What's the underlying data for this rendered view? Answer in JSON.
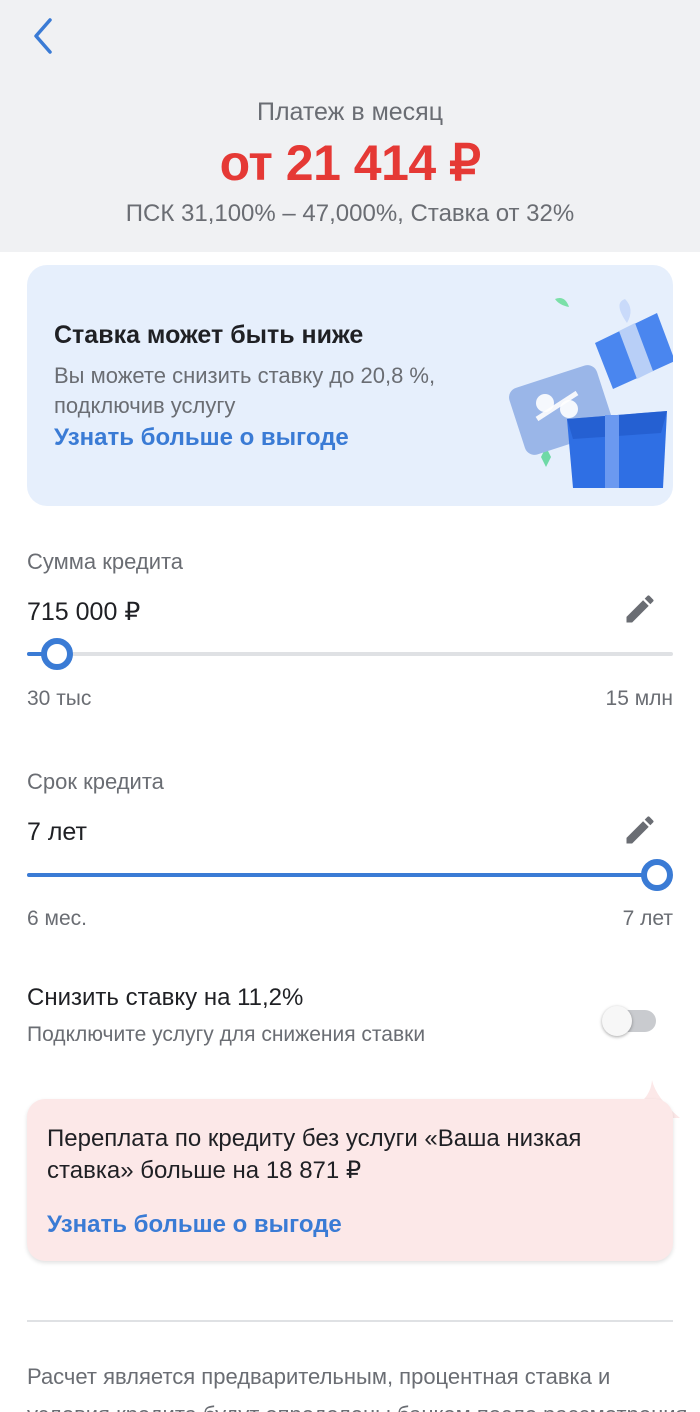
{
  "header": {
    "back_icon": "chevron-left-icon",
    "payment_label": "Платеж в месяц",
    "payment_amount": "от 21 414 ₽",
    "psk_text": "ПСК 31,100% – 47,000%, Ставка от 32%"
  },
  "promo": {
    "title": "Ставка может быть ниже",
    "text": "Вы можете снизить ставку до 20,8 %, подключив услугу",
    "link": "Узнать больше о выгоде",
    "image_icon": "gift-box-icon"
  },
  "loan_amount": {
    "label": "Сумма кредита",
    "value": "715 000  ₽",
    "min_label": "30 тыс",
    "max_label": "15 млн",
    "slider_fraction": 0.046
  },
  "loan_term": {
    "label": "Срок кредита",
    "value": "7  лет",
    "min_label": "6 мес.",
    "max_label": "7 лет",
    "slider_fraction": 1.0
  },
  "rate_toggle": {
    "title": "Снизить ставку на 11,2%",
    "subtitle": "Подключите услугу для снижения ставки",
    "enabled": false
  },
  "overpay_note": {
    "text": "Переплата по кредиту без услуги «Ваша низкая ставка» больше на 18 871 ₽",
    "link": "Узнать больше о выгоде"
  },
  "disclaimer": {
    "line1": "Расчет является предварительным, процентная ставка и",
    "line2": "условия кредита будут определены банком после рассмотрения"
  },
  "colors": {
    "accent": "#3a7bd5",
    "amount_red": "#e53935",
    "header_bg": "#f0f1f3",
    "promo_bg": "#e6effc",
    "note_bg": "#fce8e8"
  }
}
